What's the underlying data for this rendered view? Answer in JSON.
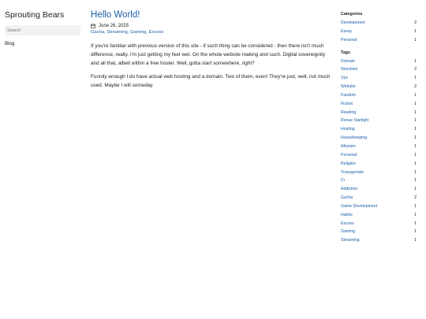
{
  "site": {
    "title": "Sprouting Bears",
    "search_placeholder": "Search",
    "nav": [
      {
        "label": "Blog"
      }
    ]
  },
  "post": {
    "title": "Hello World!",
    "date": "June 26, 2025",
    "date_icon": "calendar-icon",
    "tags": [
      "Gacha",
      "Streaming",
      "Gaming",
      "Excess"
    ],
    "paragraphs": [
      "If you're familiar with previous version of this site - if such thing can be considered - then there isn't much difference, really. I'm just getting my feet wet. On the whole website making and such. Digital sovereignity and all that, albeit within a free hoster. Well, gotta start somewhere, right?",
      "Funnily enough I do have actual web hosting and a domain. Two of them, even! They're just, well, not much used. Maybe I will someday."
    ]
  },
  "sidebar": {
    "categories_title": "Categories",
    "categories": [
      {
        "label": "Development",
        "count": "2"
      },
      {
        "label": "Essay",
        "count": "1"
      },
      {
        "label": "Personal",
        "count": "1"
      }
    ],
    "tags_title": "Tags",
    "tags": [
      {
        "label": "Domain",
        "count": "1"
      },
      {
        "label": "Neocities",
        "count": "2"
      },
      {
        "label": "Vps",
        "count": "1"
      },
      {
        "label": "Website",
        "count": "2"
      },
      {
        "label": "Fandom",
        "count": "1"
      },
      {
        "label": "Fiction",
        "count": "1"
      },
      {
        "label": "Reading",
        "count": "1"
      },
      {
        "label": "Revue Starlight",
        "count": "1"
      },
      {
        "label": "Hosting",
        "count": "1"
      },
      {
        "label": "Housekeeping",
        "count": "1"
      },
      {
        "label": "Atheism",
        "count": "1"
      },
      {
        "label": "Personal",
        "count": "1"
      },
      {
        "label": "Religion",
        "count": "1"
      },
      {
        "label": "Transgender",
        "count": "1"
      },
      {
        "label": "Ci",
        "count": "1"
      },
      {
        "label": "Addiction",
        "count": "1"
      },
      {
        "label": "Gacha",
        "count": "2"
      },
      {
        "label": "Game Development",
        "count": "1"
      },
      {
        "label": "Habits",
        "count": "1"
      },
      {
        "label": "Excess",
        "count": "1"
      },
      {
        "label": "Gaming",
        "count": "1"
      },
      {
        "label": "Streaming",
        "count": "1"
      }
    ]
  },
  "colors": {
    "link": "#1a5fa8",
    "text": "#212121",
    "search_bg": "#f2f2f2"
  }
}
